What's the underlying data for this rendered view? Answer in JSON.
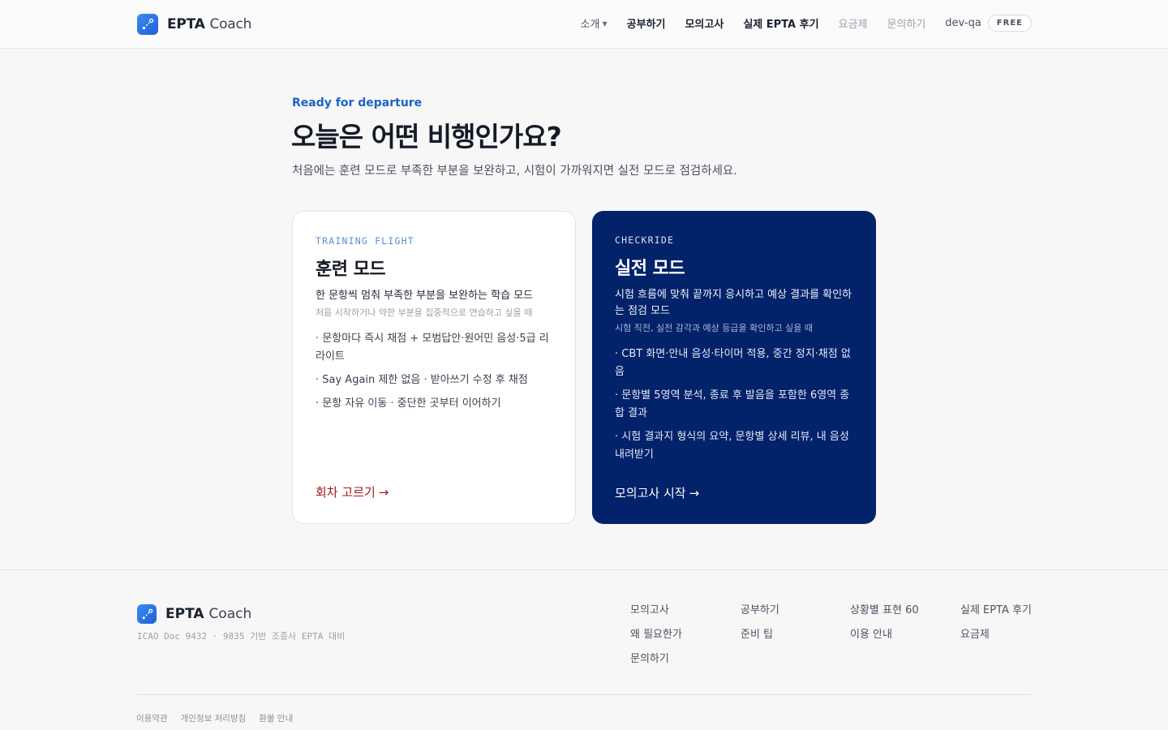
{
  "header": {
    "brand_main": "EPTA",
    "brand_sub": "Coach",
    "nav": [
      {
        "label": "소개",
        "has_caret": true
      },
      {
        "label": "공부하기"
      },
      {
        "label": "모의고사"
      },
      {
        "label": "실제 EPTA 후기"
      },
      {
        "label": "요금제"
      },
      {
        "label": "문의하기"
      }
    ],
    "user": "dev-qa",
    "plan_badge": "FREE"
  },
  "hero": {
    "eyebrow": "Ready for departure",
    "title": "오늘은 어떤 비행인가요?",
    "lead": "처음에는 훈련 모드로 부족한 부분을 보완하고, 시험이 가까워지면 실전 모드로 점검하세요."
  },
  "cards": {
    "training": {
      "tag": "TRAINING FLIGHT",
      "title": "훈련 모드",
      "desc": "한 문항씩 멈춰 부족한 부분을 보완하는 학습 모드",
      "note": "처음 시작하거나 약한 부분을 집중적으로 연습하고 싶을 때",
      "bullets": [
        "· 문항마다 즉시 채점 + 모범답안·원어민 음성·5급 리라이트",
        "· Say Again 제한 없음 · 받아쓰기 수정 후 채점",
        "· 문항 자유 이동 · 중단한 곳부터 이어하기"
      ],
      "cta": "회차 고르기",
      "cta_arrow": "→"
    },
    "checkride": {
      "tag": "CHECKRIDE",
      "title": "실전 모드",
      "desc": "시험 흐름에 맞춰 끝까지 응시하고 예상 결과를 확인하는 점검 모드",
      "note": "시험 직전, 실전 감각과 예상 등급을 확인하고 싶을 때",
      "bullets": [
        "· CBT 화면·안내 음성·타이머 적용, 중간 정지·채점 없음",
        "· 문항별 5영역 분석, 종료 후 발음을 포함한 6영역 종합 결과",
        "· 시험 결과지 형식의 요약, 문항별 상세 리뷰, 내 음성 내려받기"
      ],
      "cta": "모의고사 시작",
      "cta_arrow": "→"
    }
  },
  "footer": {
    "brand_main": "EPTA",
    "brand_sub": "Coach",
    "tagline": "ICAO Doc 9432 · 9835 기반 조종사 EPTA 대비",
    "columns": [
      [
        "모의고사",
        "왜 필요한가",
        "문의하기"
      ],
      [
        "공부하기",
        "준비 팁"
      ],
      [
        "상황별 표현 60",
        "이용 안내"
      ],
      [
        "실제 EPTA 후기",
        "요금제"
      ]
    ],
    "legal": [
      "이용약관",
      "개인정보 처리방침",
      "환불 안내"
    ]
  },
  "colors": {
    "accent_blue": "#1f63c4",
    "checkride_bg": "#02226a",
    "training_cta": "#a01818"
  },
  "icons": {
    "logo": "flight-path-icon"
  }
}
